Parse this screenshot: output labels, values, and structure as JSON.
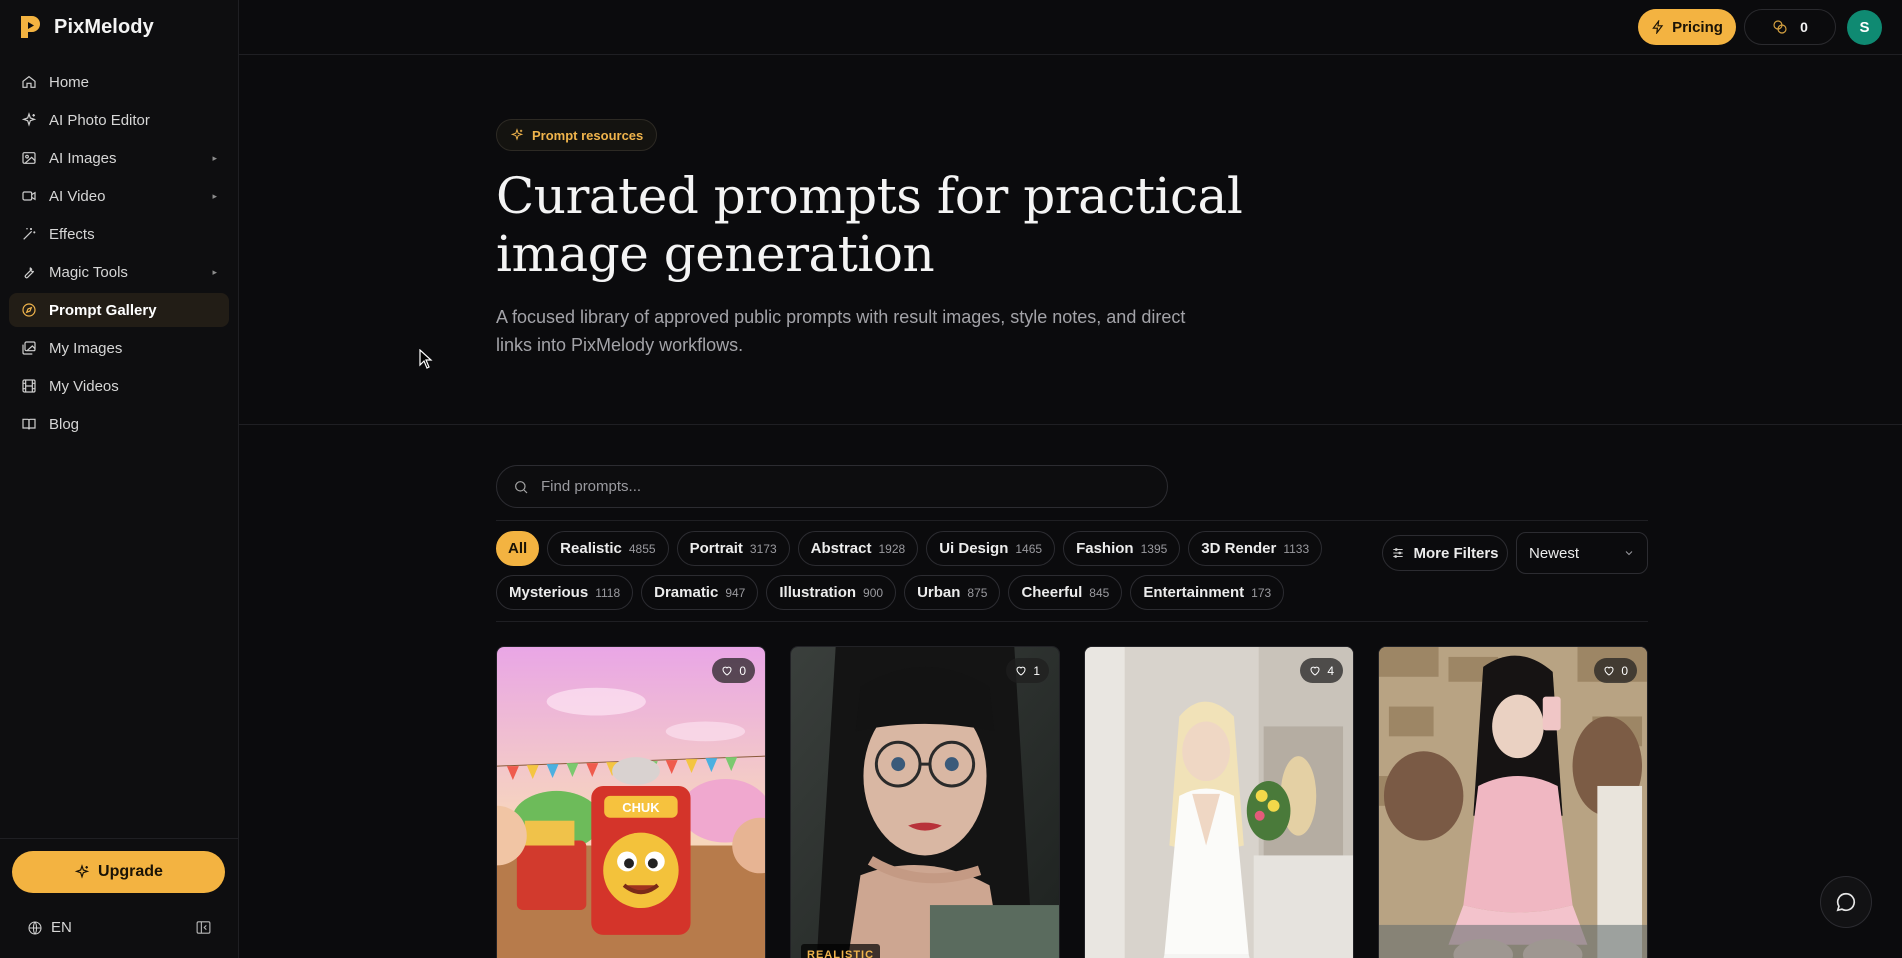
{
  "brand": {
    "name": "PixMelody"
  },
  "sidebar": {
    "items": [
      {
        "label": "Home",
        "icon": "home-icon",
        "caret": false,
        "active": false
      },
      {
        "label": "AI Photo Editor",
        "icon": "sparkle-icon",
        "caret": false,
        "active": false
      },
      {
        "label": "AI Images",
        "icon": "image-icon",
        "caret": true,
        "active": false
      },
      {
        "label": "AI Video",
        "icon": "video-icon",
        "caret": true,
        "active": false
      },
      {
        "label": "Effects",
        "icon": "wand-icon",
        "caret": false,
        "active": false
      },
      {
        "label": "Magic Tools",
        "icon": "wrench-icon",
        "caret": true,
        "active": false
      },
      {
        "label": "Prompt Gallery",
        "icon": "compass-icon",
        "caret": false,
        "active": true
      },
      {
        "label": "My Images",
        "icon": "images-icon",
        "caret": false,
        "active": false
      },
      {
        "label": "My Videos",
        "icon": "film-icon",
        "caret": false,
        "active": false
      },
      {
        "label": "Blog",
        "icon": "book-icon",
        "caret": false,
        "active": false
      }
    ],
    "caret_glyph": "▸",
    "upgrade_label": "Upgrade",
    "language": "EN"
  },
  "topbar": {
    "pricing_label": "Pricing",
    "credits": "0",
    "avatar_initial": "S"
  },
  "hero": {
    "badge": "Prompt resources",
    "title": "Curated prompts for practical image generation",
    "subtitle": "A focused library of approved public prompts with result images, style notes, and direct links into PixMelody workflows."
  },
  "search": {
    "placeholder": "Find prompts..."
  },
  "filters": {
    "rows": [
      [
        {
          "label": "All",
          "count": "",
          "active": true
        },
        {
          "label": "Realistic",
          "count": "4855",
          "active": false
        },
        {
          "label": "Portrait",
          "count": "3173",
          "active": false
        },
        {
          "label": "Abstract",
          "count": "1928",
          "active": false
        },
        {
          "label": "Ui Design",
          "count": "1465",
          "active": false
        },
        {
          "label": "Fashion",
          "count": "1395",
          "active": false
        },
        {
          "label": "3D Render",
          "count": "1133",
          "active": false
        }
      ],
      [
        {
          "label": "Mysterious",
          "count": "1118",
          "active": false
        },
        {
          "label": "Dramatic",
          "count": "947",
          "active": false
        },
        {
          "label": "Illustration",
          "count": "900",
          "active": false
        },
        {
          "label": "Urban",
          "count": "875",
          "active": false
        },
        {
          "label": "Cheerful",
          "count": "845",
          "active": false
        },
        {
          "label": "Entertainment",
          "count": "173",
          "active": false
        }
      ]
    ],
    "more_filters_label": "More Filters",
    "sort_value": "Newest"
  },
  "cards": [
    {
      "likes": "0",
      "tag": "",
      "palette": "cartoon-train"
    },
    {
      "likes": "1",
      "tag": "REALISTIC",
      "palette": "portrait-glasses"
    },
    {
      "likes": "4",
      "tag": "",
      "palette": "blonde-white-dress"
    },
    {
      "likes": "0",
      "tag": "",
      "palette": "pink-dress-mirror"
    }
  ],
  "colors": {
    "accent": "#f3b341",
    "background": "#0b0b0d",
    "sidebar_bg": "#0e0e10",
    "active_item_bg": "#221d16",
    "avatar": "#0f8a72"
  }
}
